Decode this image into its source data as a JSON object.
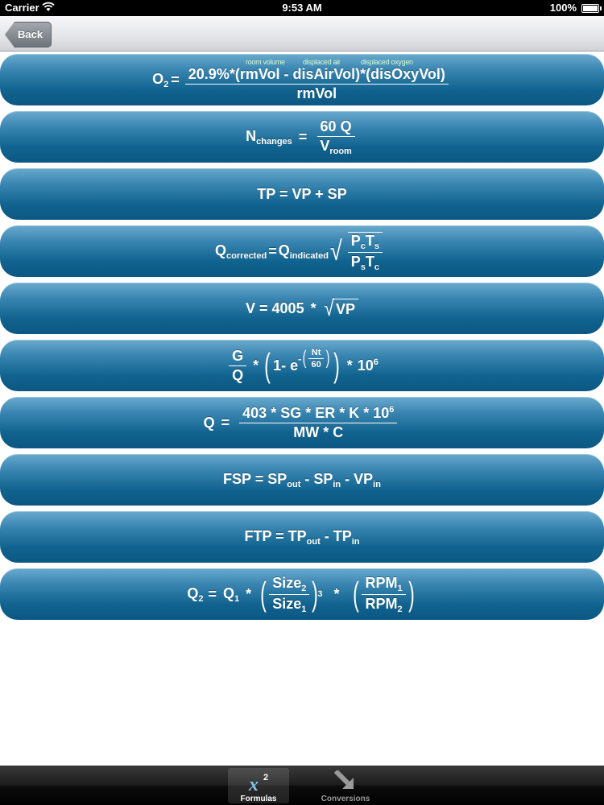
{
  "status_bar": {
    "carrier": "Carrier",
    "time": "9:53 AM",
    "battery": "100%"
  },
  "nav": {
    "back_label": "Back"
  },
  "formulas": {
    "f1": {
      "lhs": "O",
      "lhs_sub": "2",
      "eq": "=",
      "numerator": "20.9%*(rmVol - disAirVol)*(disOxyVol)",
      "denominator": "rmVol",
      "annotations": [
        "room volume",
        "displaced air",
        "displaced oxygen"
      ]
    },
    "f2": {
      "lhs": "N",
      "lhs_sub": "changes",
      "eq": "=",
      "numerator": "60 Q",
      "den": "V",
      "den_sub": "room"
    },
    "f3": {
      "text": "TP = VP + SP"
    },
    "f4": {
      "lhs": "Q",
      "lhs_sub": "corrected",
      "eq": "=",
      "q": "Q",
      "q_sub": "indicated",
      "num_a": "P",
      "num_a_sub": "c",
      "num_b": "T",
      "num_b_sub": "s",
      "den_a": "P",
      "den_a_sub": "s",
      "den_b": "T",
      "den_b_sub": "c"
    },
    "f5": {
      "lhs": "V = 4005",
      "op": "*",
      "radicand": "VP"
    },
    "f6": {
      "num": "G",
      "den": "Q",
      "op1": "*",
      "inner": "1- e",
      "minus": "-",
      "exp_num": "Nt",
      "exp_den": "60",
      "op2": "*",
      "ten": "10",
      "ten_exp": "6"
    },
    "f7": {
      "lhs": "Q",
      "eq": "=",
      "numerator": "403 * SG * ER * K * 10",
      "num_exp": "6",
      "denominator": "MW * C"
    },
    "f8": {
      "a": "FSP = SP",
      "a_sub": "out",
      "b": " - SP",
      "b_sub": "in",
      "c": " - VP",
      "c_sub": "in"
    },
    "f9": {
      "a": "FTP = TP",
      "a_sub": "out",
      "b": " - TP",
      "b_sub": "in"
    },
    "f10": {
      "lhs": "Q",
      "lhs_sub": "2",
      "eq": "=",
      "q": "Q",
      "q_sub": "1",
      "op1": "*",
      "size_num": "Size",
      "size_num_sub": "2",
      "size_den": "Size",
      "size_den_sub": "1",
      "power": "3",
      "op2": "*",
      "rpm_num": "RPM",
      "rpm_num_sub": "1",
      "rpm_den": "RPM",
      "rpm_den_sub": "2"
    }
  },
  "tabs": [
    {
      "label": "Formulas",
      "icon": "x-squared-icon",
      "active": true
    },
    {
      "label": "Conversions",
      "icon": "arrow-down-right-icon",
      "active": false
    }
  ],
  "colors": {
    "row_top": "#6aaace",
    "row_bottom": "#0c5783",
    "annotation": "#d8fbd0",
    "tabbar": "#1c1c1c"
  }
}
